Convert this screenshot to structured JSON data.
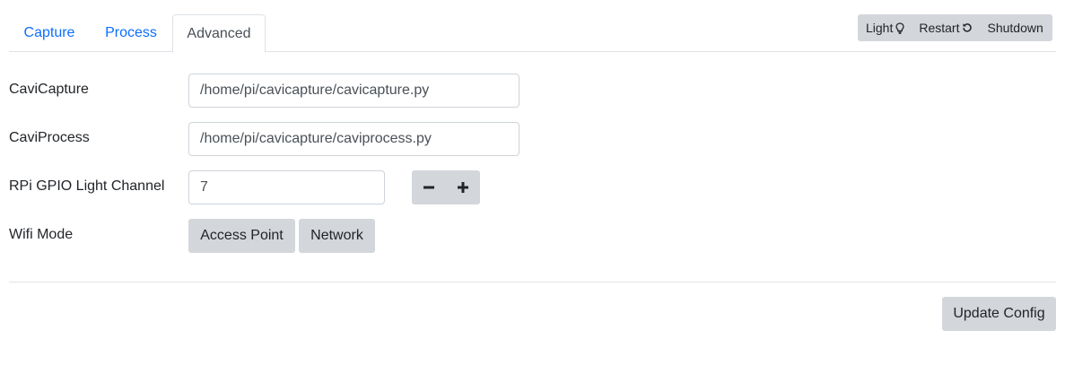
{
  "tabs": [
    {
      "label": "Capture",
      "active": false
    },
    {
      "label": "Process",
      "active": false
    },
    {
      "label": "Advanced",
      "active": true
    }
  ],
  "system": {
    "light_label": "Light",
    "restart_label": "Restart",
    "shutdown_label": "Shutdown",
    "light_icon": "lightbulb-icon",
    "restart_icon": "restart-icon"
  },
  "form": {
    "cavicapture": {
      "label": "CaviCapture",
      "value": "/home/pi/cavicapture/cavicapture.py"
    },
    "caviprocess": {
      "label": "CaviProcess",
      "value": "/home/pi/cavicapture/caviprocess.py"
    },
    "gpio": {
      "label": "RPi GPIO Light Channel",
      "value": "7",
      "decrement_icon": "minus-icon",
      "increment_icon": "plus-icon"
    },
    "wifi": {
      "label": "Wifi Mode",
      "options": [
        "Access Point",
        "Network"
      ]
    }
  },
  "footer": {
    "update_label": "Update Config"
  },
  "colors": {
    "link": "#0d6efd",
    "button_bg": "#d3d6da",
    "border": "#dee2e6"
  }
}
